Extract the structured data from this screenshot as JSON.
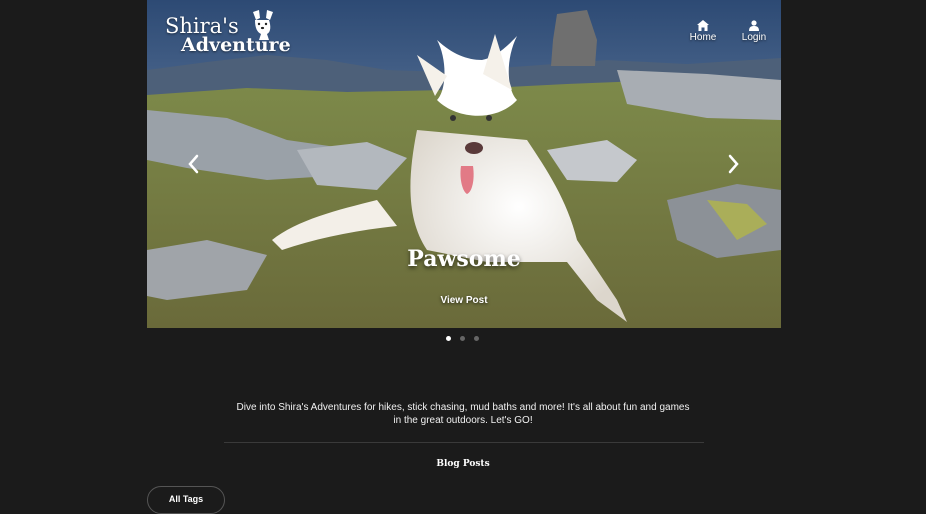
{
  "logo": {
    "line1": "Shira's",
    "line2": "Adventure"
  },
  "nav": {
    "home_label": "Home",
    "login_label": "Login"
  },
  "carousel": {
    "slide_title": "Pawsome",
    "view_post_label": "View Post",
    "slide_count": 3,
    "active_index": 0
  },
  "intro": {
    "text": "Dive into Shira's Adventures for hikes, stick chasing, mud baths and more! It's all about fun and games in the great outdoors. Let's GO!"
  },
  "section": {
    "title": "Blog Posts"
  },
  "filters": {
    "all_tags_label": "All Tags"
  },
  "colors": {
    "background": "#1b1b1b",
    "text": "#ffffff",
    "dot_active": "#ffffff",
    "dot_inactive": "#666666"
  }
}
